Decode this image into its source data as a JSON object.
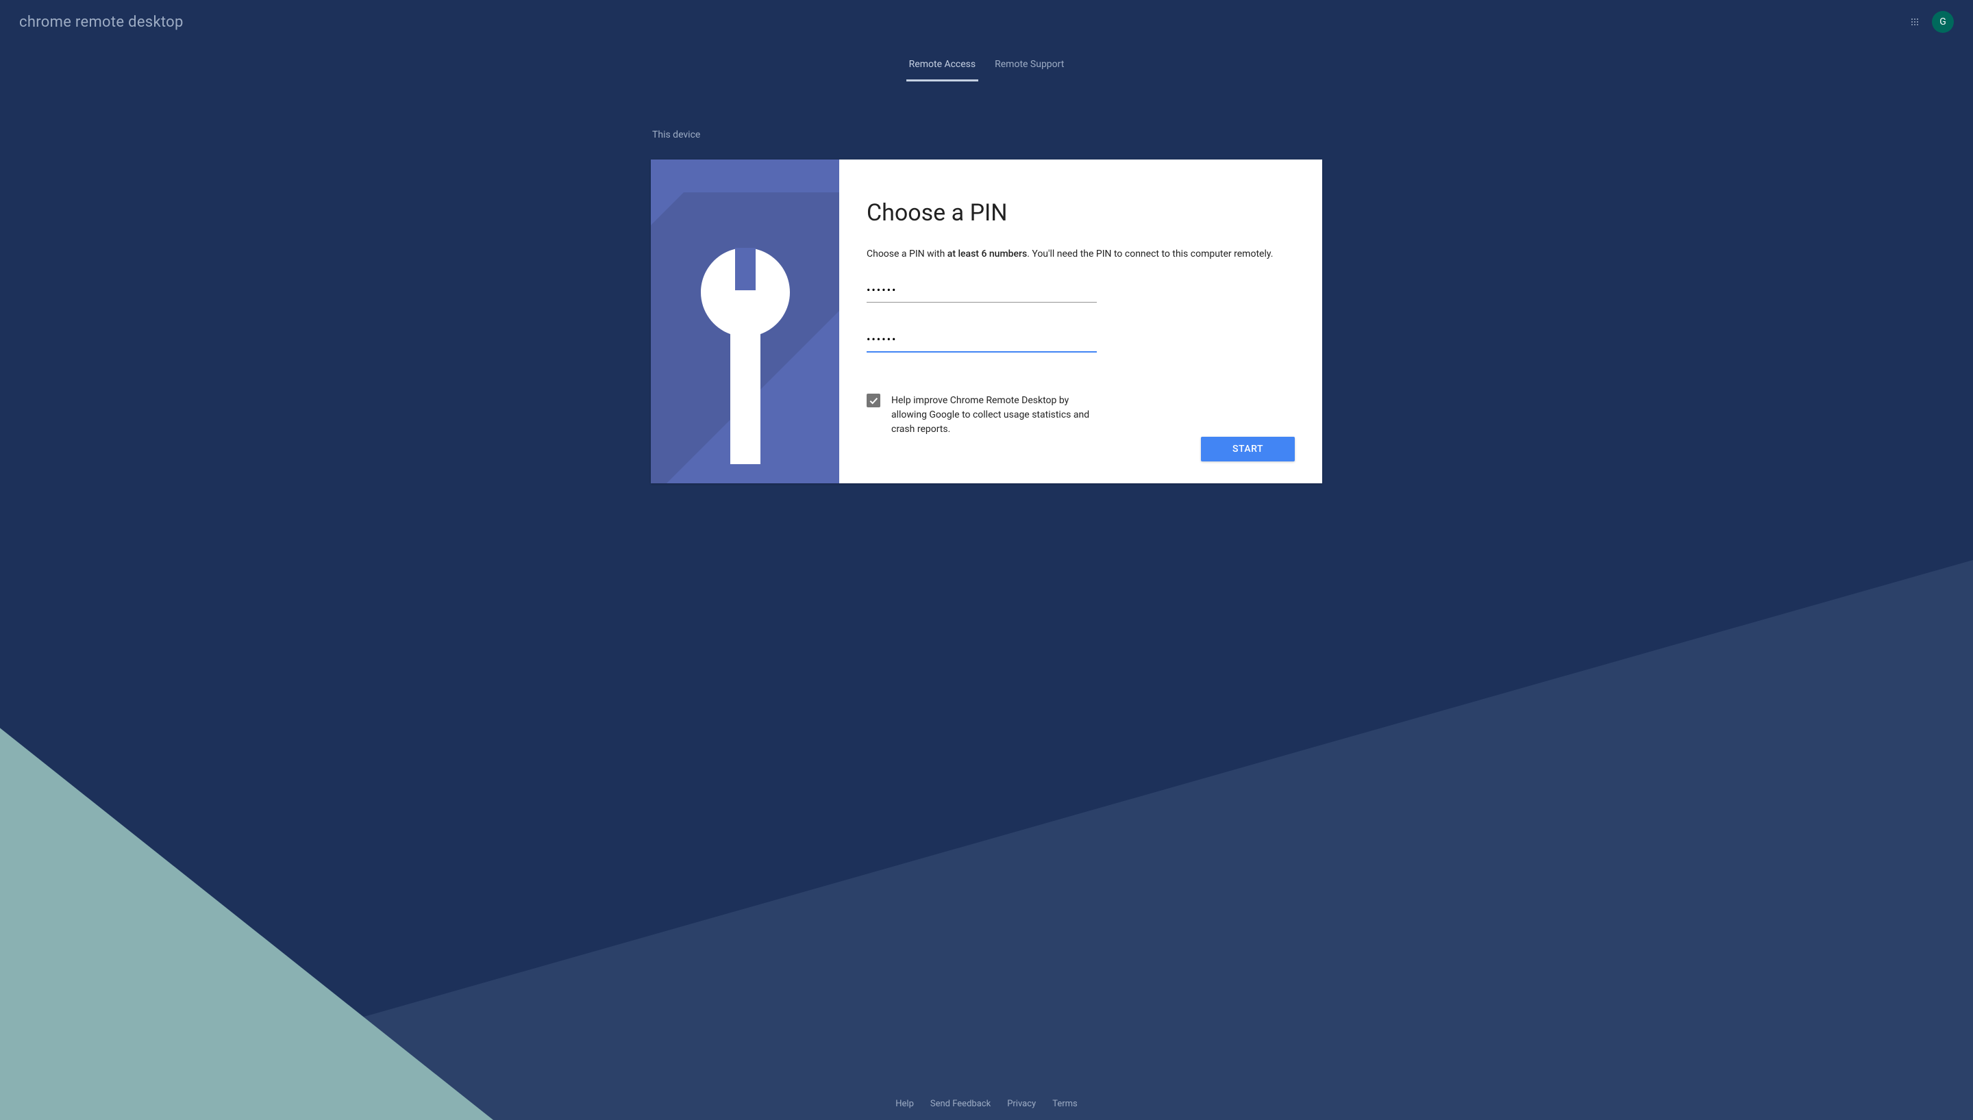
{
  "header": {
    "app_title": "chrome remote desktop",
    "avatar_letter": "G"
  },
  "nav": {
    "tabs": [
      {
        "label": "Remote Access",
        "active": true
      },
      {
        "label": "Remote Support",
        "active": false
      }
    ]
  },
  "main": {
    "section_label": "This device",
    "card": {
      "title": "Choose a PIN",
      "description_prefix": "Choose a PIN with ",
      "description_bold": "at least 6 numbers",
      "description_suffix": ". You'll need the PIN to connect to this computer remotely.",
      "pin_input_1_value": "••••••",
      "pin_input_2_value": "••••••",
      "checkbox_checked": true,
      "checkbox_label": "Help improve Chrome Remote Desktop by allowing Google to collect usage statistics and crash reports.",
      "start_button": "START"
    }
  },
  "footer": {
    "links": [
      {
        "label": "Help"
      },
      {
        "label": "Send Feedback"
      },
      {
        "label": "Privacy"
      },
      {
        "label": "Terms"
      }
    ]
  }
}
